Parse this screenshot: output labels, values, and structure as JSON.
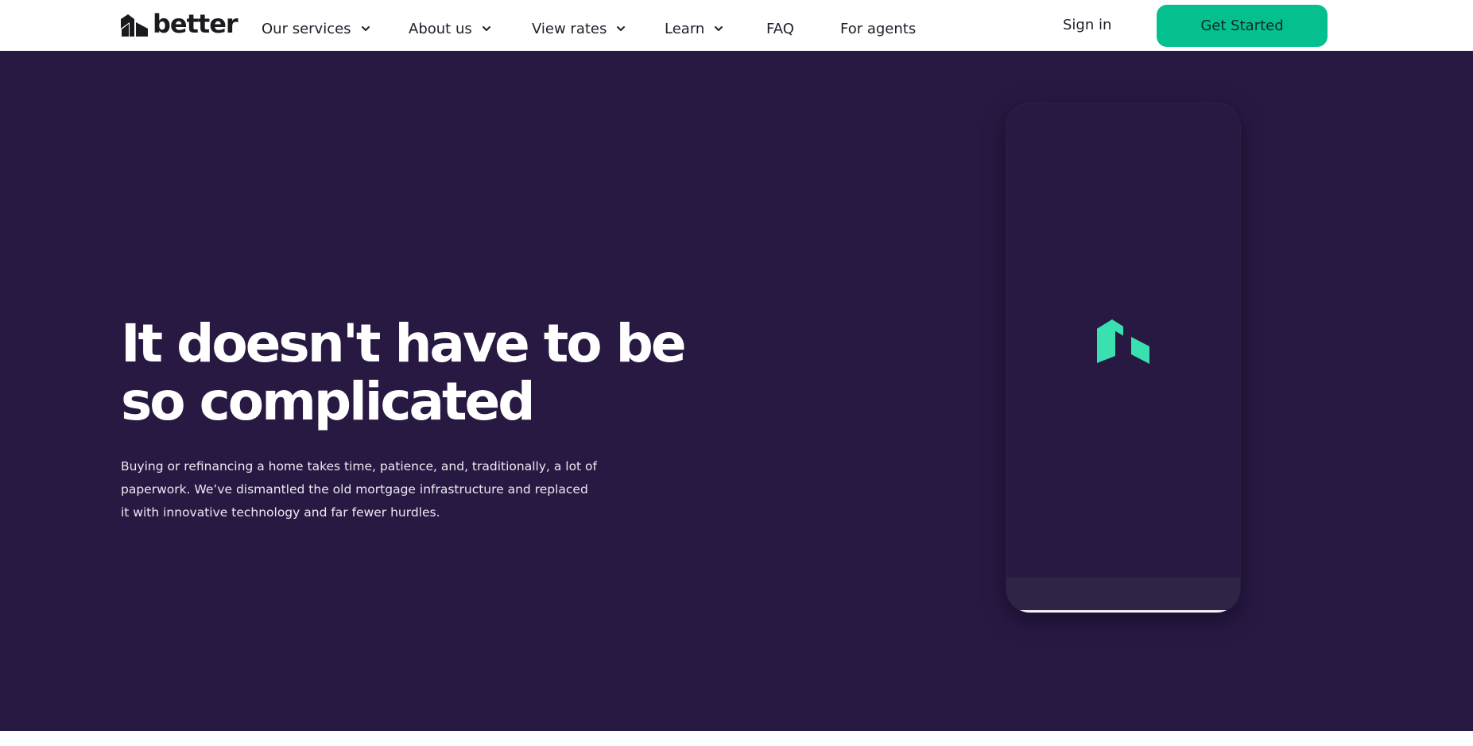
{
  "brand": {
    "name": "better",
    "accent": "#04c08f",
    "hero_bg": "#281942",
    "logo_green": "#3be0b0",
    "icon": "house-logo-icon"
  },
  "nav": {
    "items": [
      {
        "label": "Our services",
        "has_dropdown": true
      },
      {
        "label": "About us",
        "has_dropdown": true
      },
      {
        "label": "View rates",
        "has_dropdown": true
      },
      {
        "label": "Learn",
        "has_dropdown": true
      },
      {
        "label": "FAQ",
        "has_dropdown": false
      },
      {
        "label": "For agents",
        "has_dropdown": false
      }
    ],
    "signin_label": "Sign in",
    "cta_label": "Get Started"
  },
  "hero": {
    "title": "It doesn't have to be so complicated",
    "description": "Buying or refinancing a home takes time, patience, and, traditionally, a lot of paperwork. We’ve dismantled the old mortgage infrastructure and replaced it with innovative technology and far fewer hurdles."
  }
}
